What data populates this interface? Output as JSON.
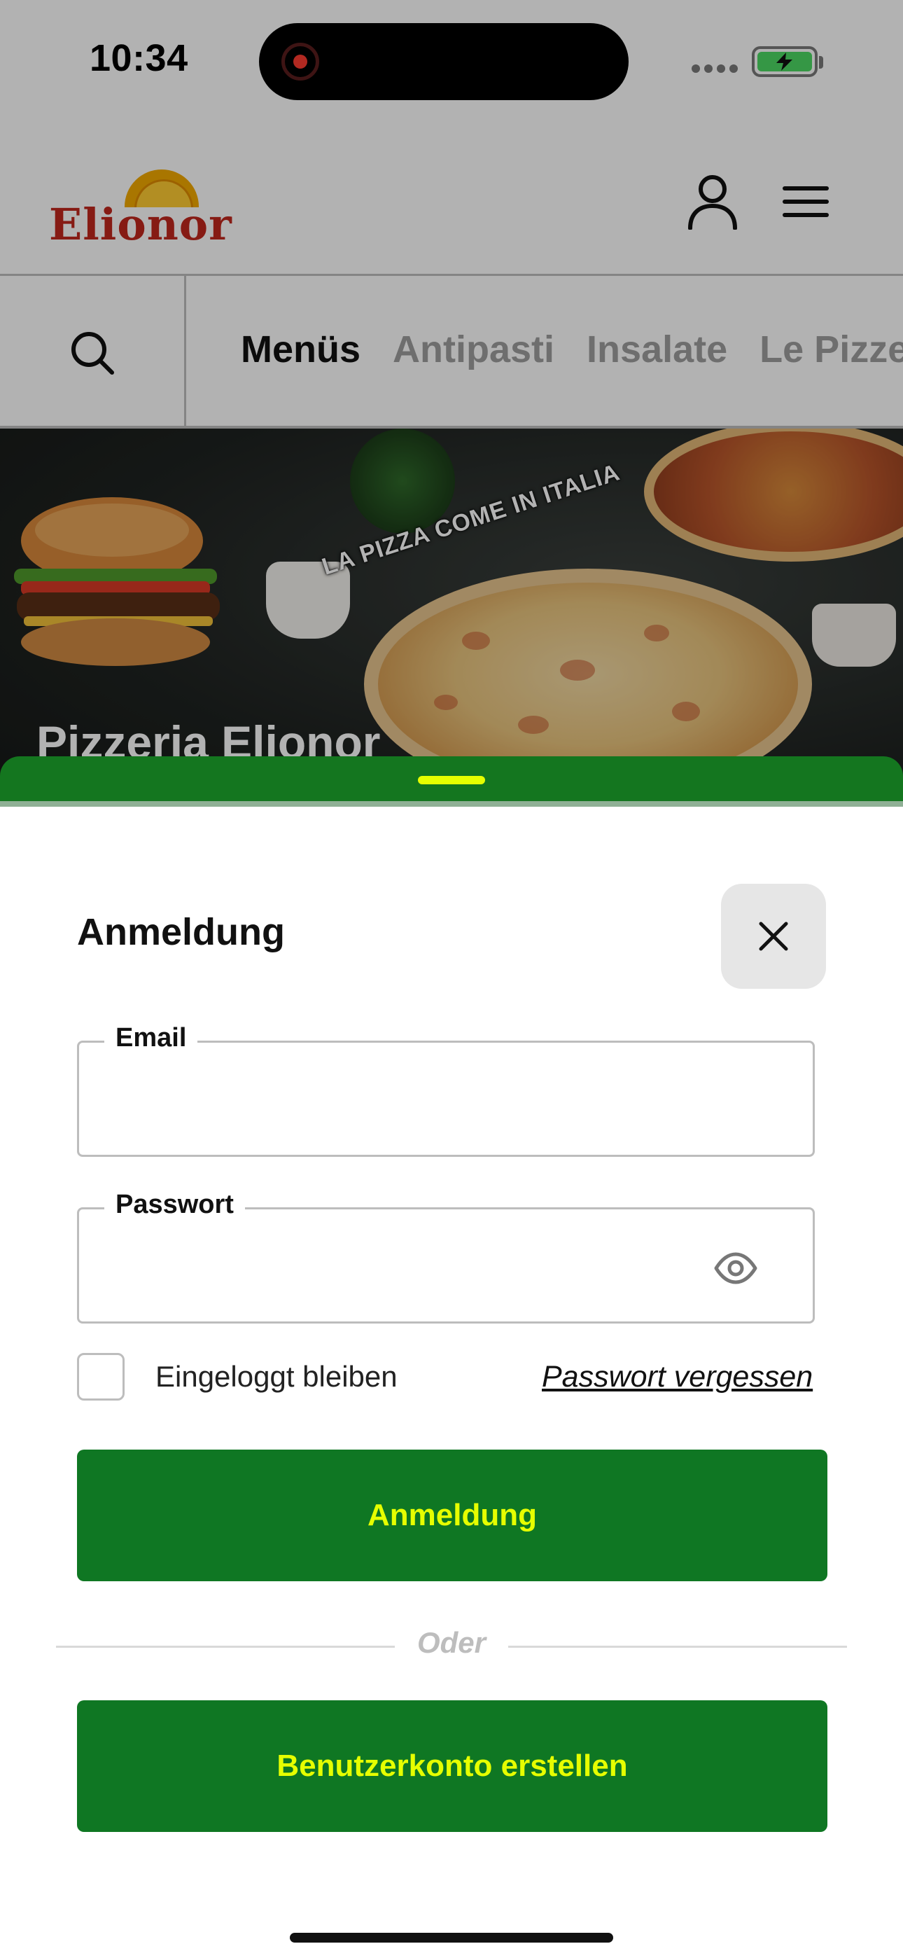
{
  "status_bar": {
    "time": "10:34"
  },
  "header": {
    "logo_text": "Elionor"
  },
  "categories": {
    "items": [
      "Menüs",
      "Antipasti",
      "Insalate",
      "Le Pizze"
    ],
    "active": "Menüs"
  },
  "hero": {
    "arc_text": "LA PIZZA COME IN ITALIA",
    "title": "Pizzeria Elionor"
  },
  "login": {
    "title": "Anmeldung",
    "email_label": "Email",
    "email_value": "",
    "password_label": "Passwort",
    "password_value": "",
    "remember_label": "Eingeloggt bleiben",
    "forgot_label": "Passwort vergessen",
    "submit_label": "Anmeldung",
    "divider_text": "Oder",
    "register_label": "Benutzerkonto erstellen"
  },
  "colors": {
    "brand_green": "#0f7723",
    "accent_yellow": "#e6ff00",
    "logo_red": "#c1271d"
  }
}
